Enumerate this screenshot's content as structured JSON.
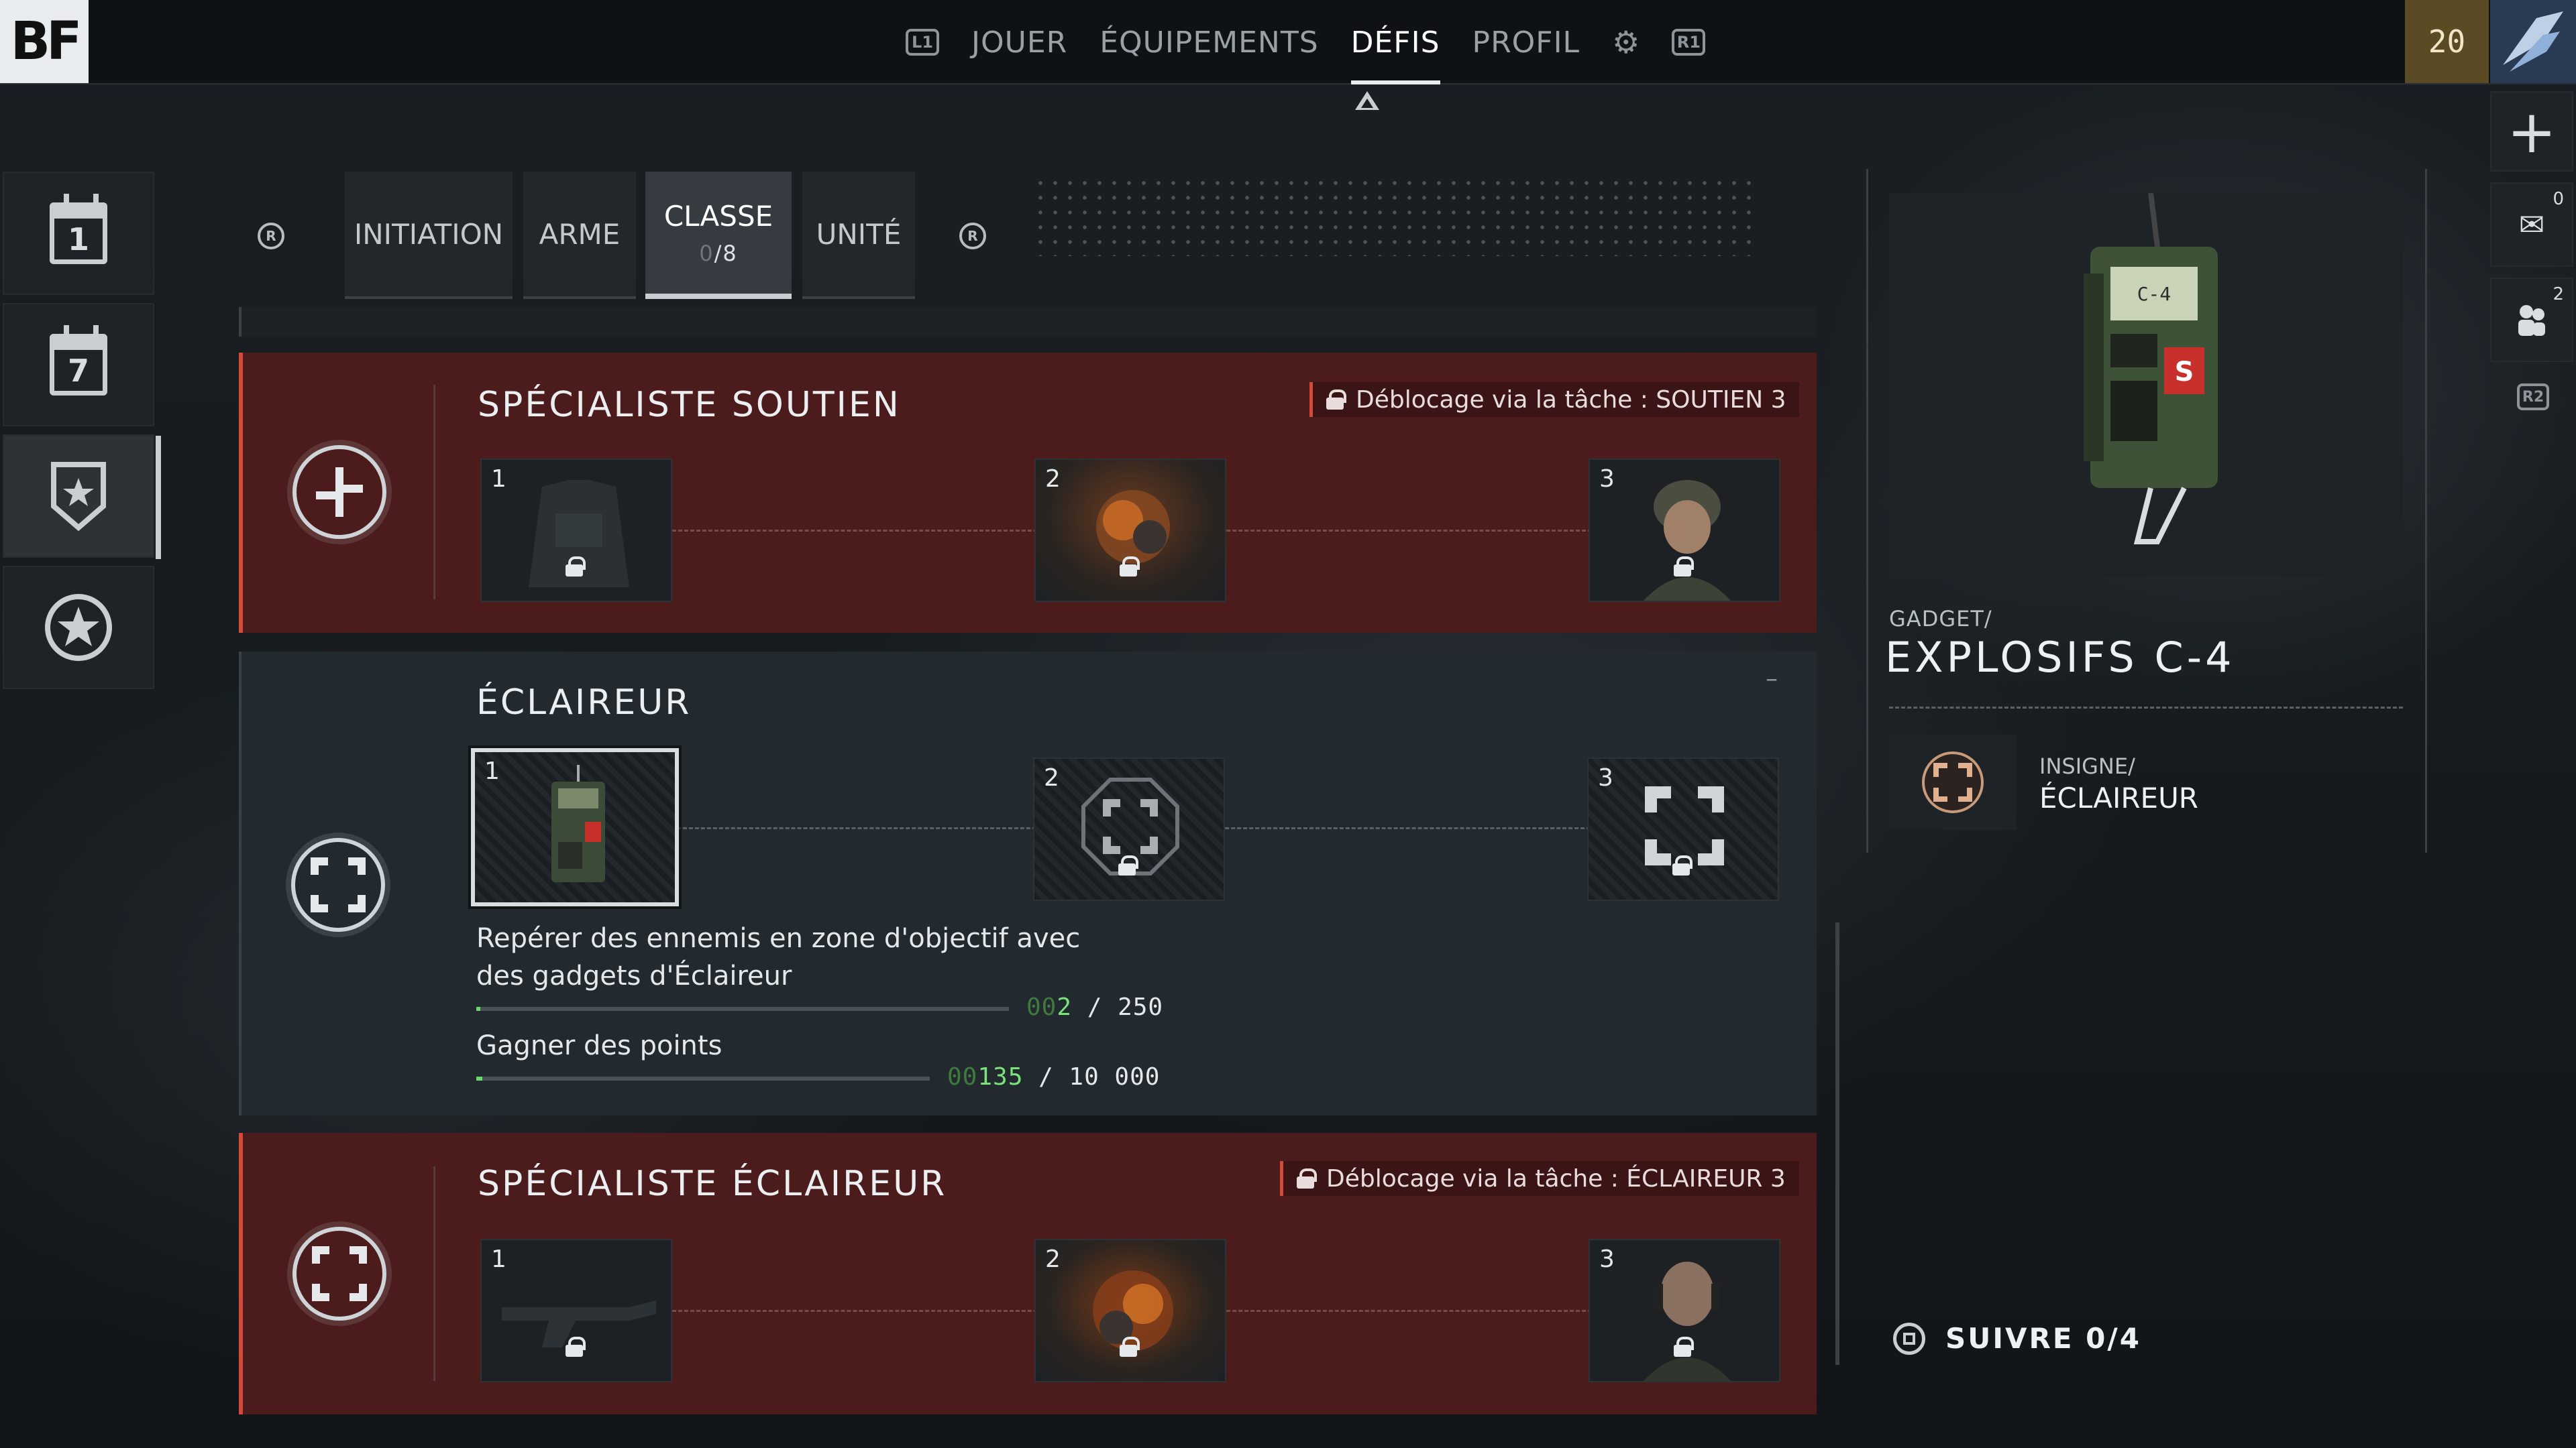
{
  "header": {
    "logo": "BF",
    "nav_left_key": "L1",
    "nav_right_key": "R1",
    "nav_items": [
      "JOUER",
      "ÉQUIPEMENTS",
      "DÉFIS",
      "PROFIL"
    ],
    "active_nav": "DÉFIS",
    "player_level": "20"
  },
  "sidebar": {
    "daily_label": "1",
    "weekly_label": "7"
  },
  "tabs": {
    "left_key": "R",
    "right_key": "R",
    "items": [
      "INITIATION",
      "ARME",
      "CLASSE",
      "UNITÉ"
    ],
    "active": "CLASSE",
    "classe_progress_dim": "0",
    "classe_progress": "/8"
  },
  "cards": {
    "soutien": {
      "title": "SPÉCIALISTE SOUTIEN",
      "unlock": "Déblocage via la tâche : SOUTIEN 3",
      "slots": [
        "1",
        "2",
        "3"
      ]
    },
    "eclaireur": {
      "title": "ÉCLAIREUR",
      "slots": [
        "1",
        "2",
        "3"
      ],
      "task1": {
        "desc_line1": "Repérer des ennemis en zone d'objectif avec",
        "desc_line2": "des gadgets d'Éclaireur",
        "zeros": "00",
        "current": "2",
        "total": " / 250",
        "progress": 0.008
      },
      "task2": {
        "desc": "Gagner des points",
        "zeros": "00",
        "current": "135",
        "total": " / 10 000",
        "progress": 0.0135
      },
      "minus": "–"
    },
    "specialiste_eclaireur": {
      "title": "SPÉCIALISTE ÉCLAIREUR",
      "unlock": "Déblocage via la tâche : ÉCLAIREUR 3",
      "slots": [
        "1",
        "2",
        "3"
      ]
    }
  },
  "reward": {
    "category": "GADGET/",
    "name": "EXPLOSIFS C-4",
    "insignia_category": "INSIGNE/",
    "insignia_name": "ÉCLAIREUR",
    "device_screen_text": "C-4"
  },
  "follow": {
    "label": "SUIVRE 0/4"
  },
  "right_bar": {
    "mail_count": "0",
    "squad_count": "2",
    "key": "R2"
  },
  "colors": {
    "locked_card": "#4c1c1c",
    "locked_accent": "#d44a3a",
    "progress_green": "#7be27b",
    "level_badge": "#5b4b24"
  }
}
